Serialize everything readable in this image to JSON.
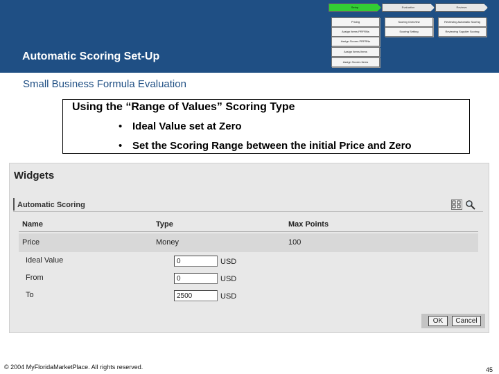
{
  "slide": {
    "title": "Automatic Scoring Set-Up",
    "subtitle": "Small Business Formula Evaluation",
    "info_box": {
      "heading": "Using the “Range of Values” Scoring Type",
      "bullets": [
        "Ideal Value set at Zero",
        "Set the Scoring Range between the initial Price and Zero"
      ],
      "bullet_glyph": "•"
    },
    "footer": {
      "copyright": "© 2004 MyFloridaMarketPlace. All rights reserved.",
      "page_number": "45"
    }
  },
  "process_flow": {
    "stages": [
      {
        "label": "Setup",
        "active": true
      },
      {
        "label": "Evaluation",
        "active": false
      },
      {
        "label": "Reviews",
        "active": false
      }
    ],
    "steps": [
      {
        "label": "Pricing"
      },
      {
        "label": "Scoring Overview"
      },
      {
        "label": "Reviewing Automatic Scoring"
      },
      {
        "label": "Assign Items PRFRNs"
      },
      {
        "label": "Scoring Setting"
      },
      {
        "label": "Reviewing Supplier Scoring"
      },
      {
        "label": "Assign Scores PRFRNs"
      },
      {
        "label": "Assign Items Items"
      },
      {
        "label": "Assign Scores Items"
      }
    ]
  },
  "app": {
    "page_title": "Widgets",
    "section_title": "Automatic Scoring",
    "toolbar_icons": [
      "pricing-view-icon",
      "magnifier-icon"
    ],
    "table": {
      "headers": [
        "Name",
        "Type",
        "Max Points"
      ],
      "row": {
        "name": "Price",
        "type": "Money",
        "max_points": "100"
      }
    },
    "fields": [
      {
        "label": "Ideal Value",
        "value": "0",
        "unit": "USD"
      },
      {
        "label": "From",
        "value": "0",
        "unit": "USD"
      },
      {
        "label": "To",
        "value": "2500",
        "unit": "USD"
      }
    ],
    "buttons": {
      "ok": "OK",
      "cancel": "Cancel"
    }
  },
  "colors": {
    "header_band": "#1f4f84",
    "active_stage": "#33cc33",
    "subtitle_text": "#1f4f84"
  }
}
